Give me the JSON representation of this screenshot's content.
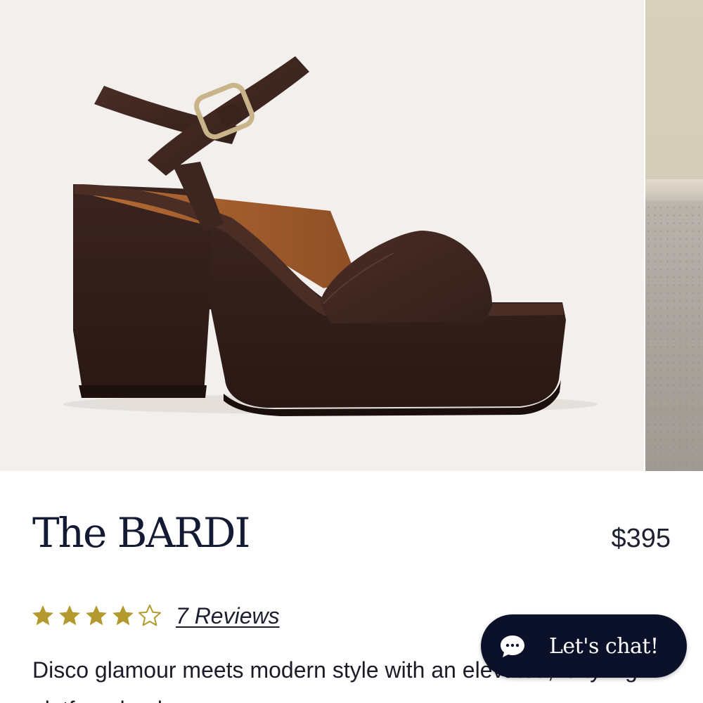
{
  "product": {
    "title": "The BARDI",
    "price": "$395",
    "rating": {
      "value": 4,
      "max": 5,
      "reviews_label": "7 Reviews",
      "star_color": "#b39a2e"
    },
    "description": "Disco glamour meets modern style with an elevated, lofty high platform heel"
  },
  "gallery": {
    "main_image": "brown-leather-platform-sandal",
    "next_image": "lifestyle-photo-partial",
    "background_color": "#f2efec"
  },
  "chat": {
    "label": "Let's chat!",
    "icon": "chat-bubble-icon",
    "background_color": "#0b1129"
  }
}
